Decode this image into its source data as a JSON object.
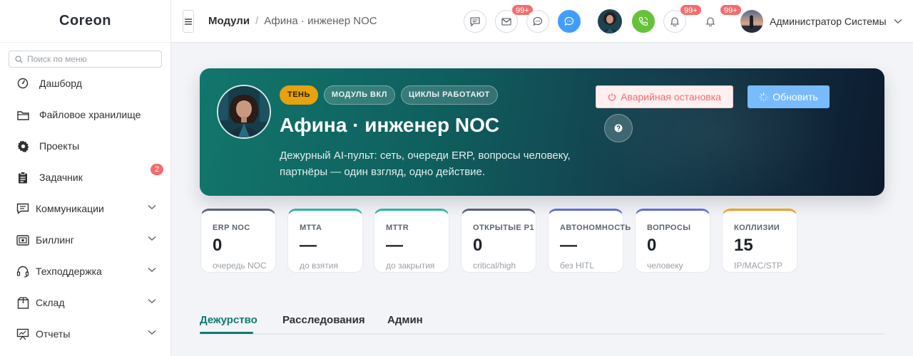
{
  "app": {
    "brand": "Coreon"
  },
  "sidebar": {
    "search_placeholder": "Поиск по меню",
    "items": [
      {
        "label": "Дашборд",
        "icon": "dashboard-icon"
      },
      {
        "label": "Файловое хранилище",
        "icon": "folder-icon"
      },
      {
        "label": "Проекты",
        "icon": "gear-icon"
      },
      {
        "label": "Задачник",
        "icon": "clipboard-icon",
        "badge": "2"
      },
      {
        "label": "Коммуникации",
        "icon": "chat-icon",
        "expandable": true
      },
      {
        "label": "Биллинг",
        "icon": "billing-icon",
        "expandable": true
      },
      {
        "label": "Техподдержка",
        "icon": "headset-icon",
        "expandable": true
      },
      {
        "label": "Склад",
        "icon": "box-icon",
        "expandable": true
      },
      {
        "label": "Отчеты",
        "icon": "chart-icon",
        "expandable": true
      }
    ]
  },
  "header": {
    "breadcrumb": [
      "Модули",
      "Афина · инженер NOC"
    ],
    "mail_badge": "99+",
    "bell_badge_1": "99+",
    "bell_badge_2": "99+",
    "user_name": "Администратор Системы"
  },
  "hero": {
    "chips": [
      "Тень",
      "Модуль ВКЛ",
      "Циклы работают"
    ],
    "title": "Афина · инженер NOC",
    "description": "Дежурный AI-пульт: сеть, очереди ERP, вопросы человеку, партнёры — один взгляд, одно действие.",
    "emergency_label": "Аварийная остановка",
    "refresh_label": "Обновить",
    "accent": "#117a70"
  },
  "stats": [
    {
      "label": "ERP NOC",
      "value": "0",
      "sub": "очередь NOC",
      "color": "#5a6072"
    },
    {
      "label": "MTTA",
      "value": "—",
      "sub": "до взятия",
      "color": "#2bb3a0"
    },
    {
      "label": "MTTR",
      "value": "—",
      "sub": "до закрытия",
      "color": "#2bb3a0"
    },
    {
      "label": "Открытые P1",
      "value": "0",
      "sub": "critical/high",
      "color": "#5a6072"
    },
    {
      "label": "Автономность",
      "value": "—",
      "sub": "без HITL",
      "color": "#5b6fd6"
    },
    {
      "label": "Вопросы",
      "value": "0",
      "sub": "человеку",
      "color": "#5b6fd6"
    },
    {
      "label": "Коллизии",
      "value": "15",
      "sub": "IP/MAC/STP",
      "color": "#f0a020"
    }
  ],
  "tabs": [
    "Дежурство",
    "Расследования",
    "Админ"
  ]
}
